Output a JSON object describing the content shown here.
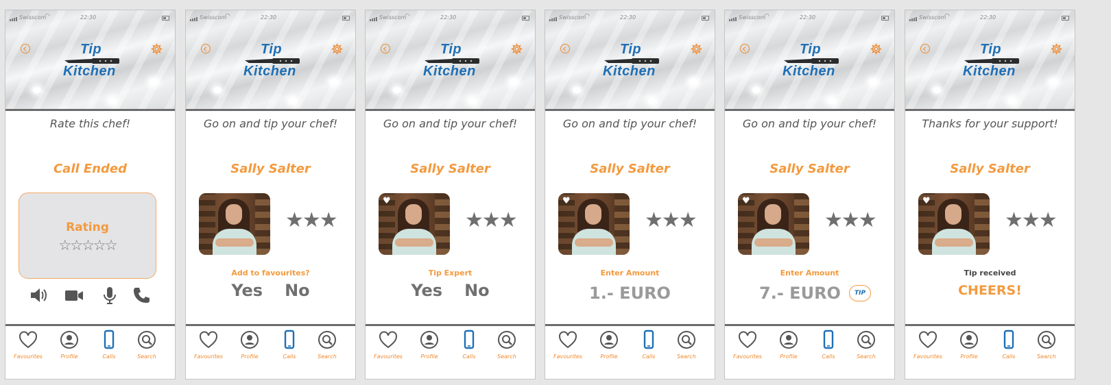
{
  "status_bar": {
    "carrier": "Swisscom",
    "time": "22:30"
  },
  "logo": {
    "line1": "Tip",
    "line2": "Kitchen"
  },
  "tabs": [
    {
      "label": "Favourites",
      "icon": "heart-icon"
    },
    {
      "label": "Profile",
      "icon": "profile-icon"
    },
    {
      "label": "Calls",
      "icon": "phone-device-icon"
    },
    {
      "label": "Search",
      "icon": "search-icon"
    }
  ],
  "colors": {
    "accent_orange": "#f39a3e",
    "brand_blue": "#1f6fb5",
    "text_gray": "#555555"
  },
  "screens": [
    {
      "headline": "Rate this chef!",
      "title": "Call Ended",
      "rating_label": "Rating",
      "rating_stars": "☆☆☆☆☆",
      "rating_value": 0,
      "call_controls": [
        "speaker-icon",
        "video-camera-icon",
        "microphone-icon",
        "phone-icon"
      ]
    },
    {
      "headline": "Go on and tip your chef!",
      "chef_name": "Sally Salter",
      "stars": "★★★",
      "question": "Add to favourites?",
      "yes": "Yes",
      "no": "No"
    },
    {
      "headline": "Go on and tip your chef!",
      "chef_name": "Sally Salter",
      "stars": "★★★",
      "favourite_badge": "♥",
      "question": "Tip Expert",
      "yes": "Yes",
      "no": "No"
    },
    {
      "headline": "Go on and tip your chef!",
      "chef_name": "Sally Salter",
      "stars": "★★★",
      "favourite_badge": "♥",
      "question": "Enter Amount",
      "amount": "1.- EURO"
    },
    {
      "headline": "Go on and tip your chef!",
      "chef_name": "Sally Salter",
      "stars": "★★★",
      "favourite_badge": "♥",
      "question": "Enter Amount",
      "amount": "7.- EURO",
      "tip_button": "TIP"
    },
    {
      "headline": "Thanks for your support!",
      "chef_name": "Sally Salter",
      "stars": "★★★",
      "favourite_badge": "♥",
      "message": "Tip received",
      "cheers": "CHEERS!"
    }
  ]
}
